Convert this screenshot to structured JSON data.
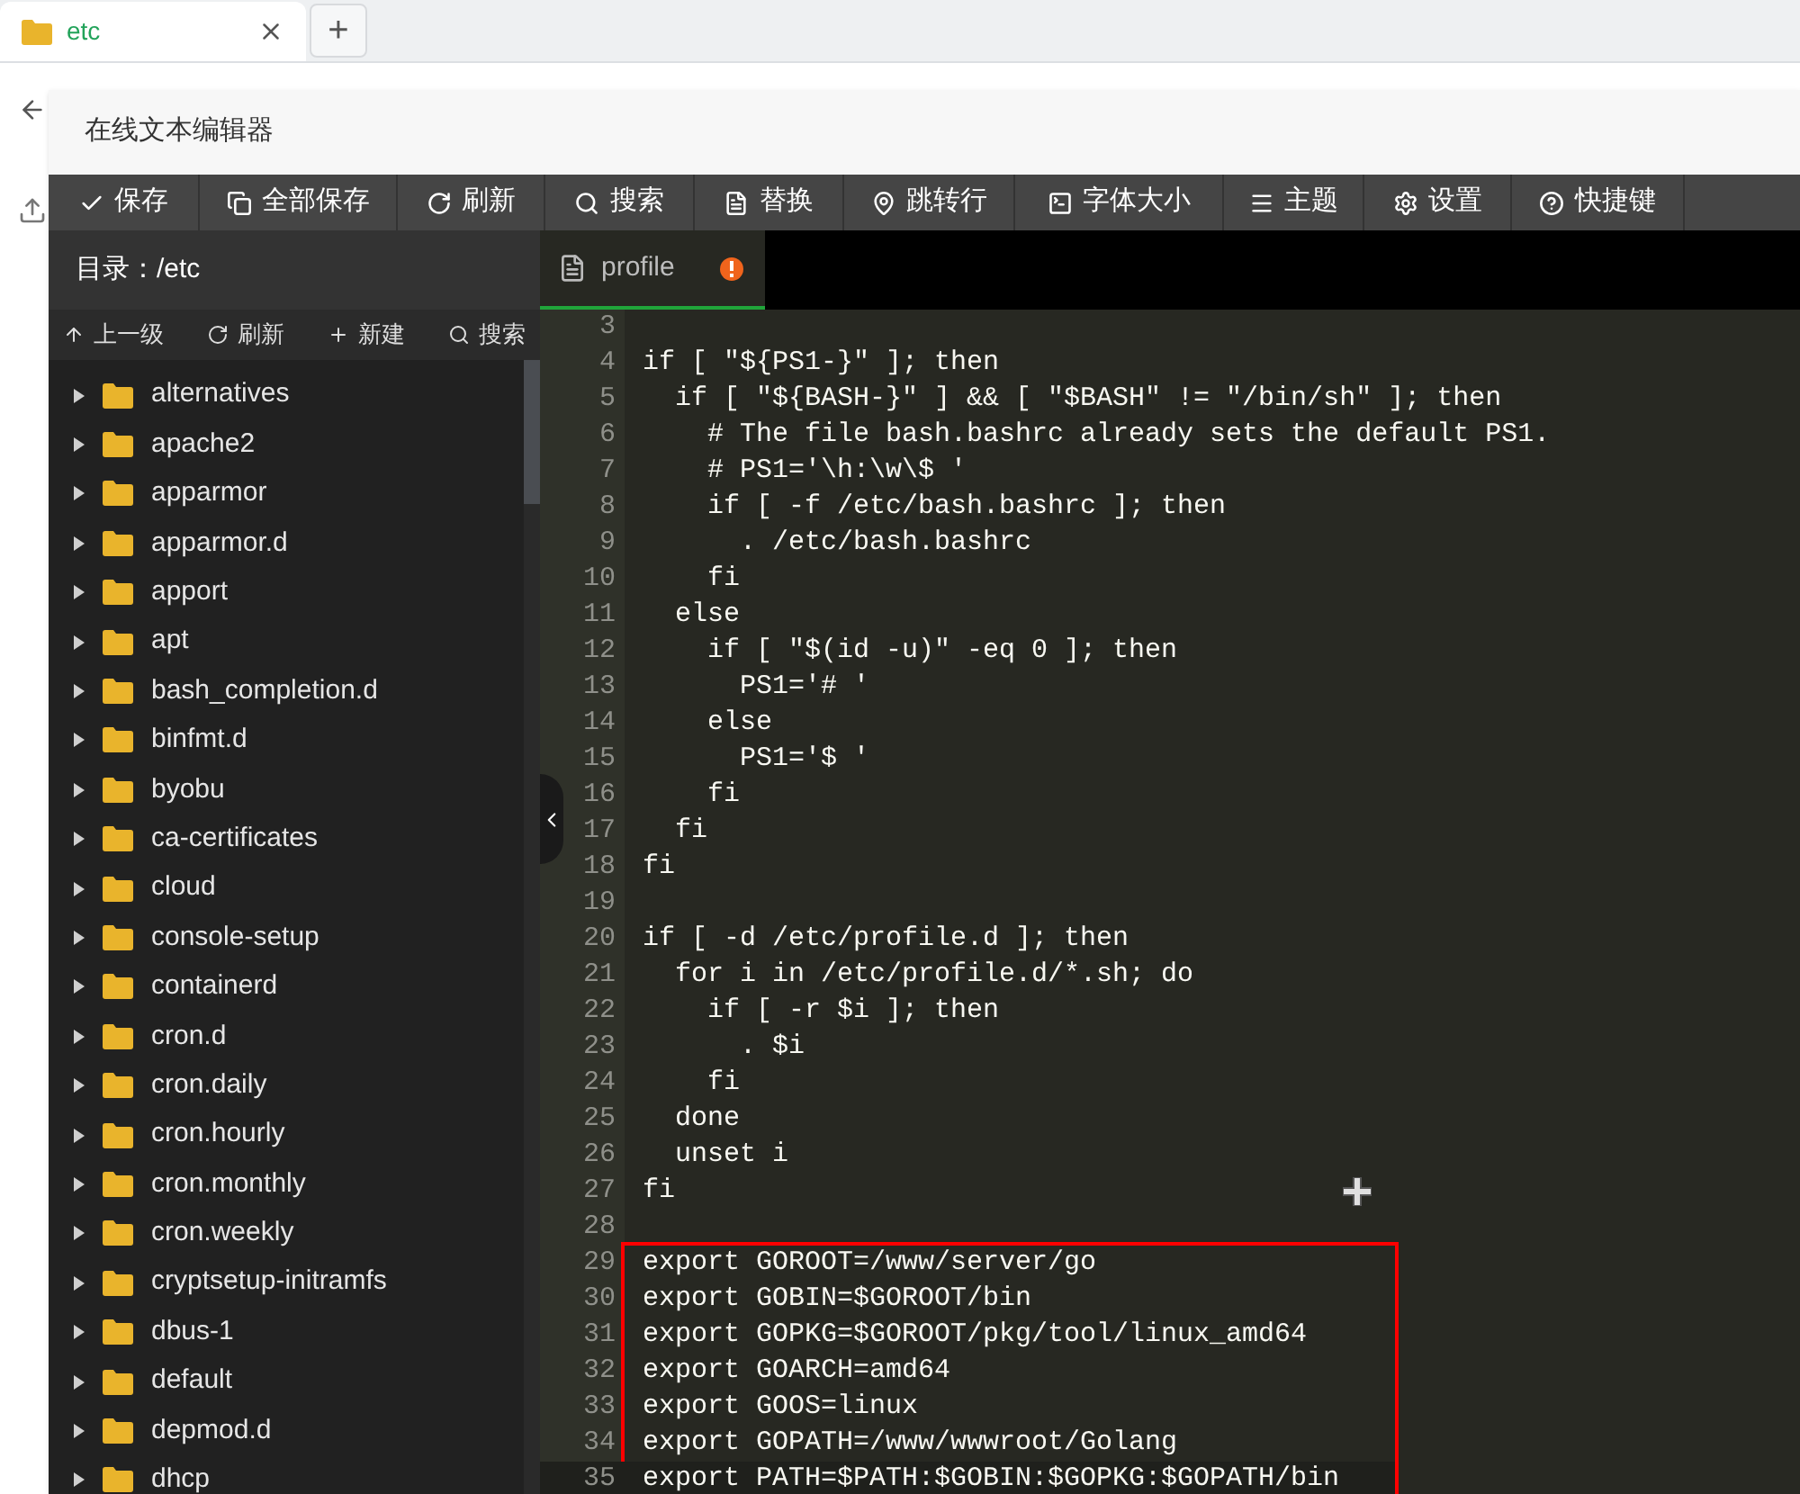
{
  "browser": {
    "tabs": [
      {
        "label": "etc",
        "selected": true
      }
    ],
    "new_tab": "+"
  },
  "window": {
    "title": "在线文本编辑器"
  },
  "toolbar": [
    {
      "label": "保存"
    },
    {
      "label": "全部保存"
    },
    {
      "label": "刷新"
    },
    {
      "label": "搜索"
    },
    {
      "label": "替换"
    },
    {
      "label": "跳转行"
    },
    {
      "label": "字体大小"
    },
    {
      "label": "主题"
    },
    {
      "label": "设置"
    },
    {
      "label": "快捷键"
    }
  ],
  "sidebar": {
    "path": "目录：/etc",
    "actions": [
      {
        "label": "上一级"
      },
      {
        "label": "刷新"
      },
      {
        "label": "新建"
      },
      {
        "label": "搜索"
      }
    ],
    "items": [
      {
        "label": "alternatives",
        "expanded": false
      },
      {
        "label": "apache2",
        "expanded": false
      },
      {
        "label": "apparmor",
        "expanded": false
      },
      {
        "label": "apparmor.d",
        "expanded": false
      },
      {
        "label": "apport",
        "expanded": false
      },
      {
        "label": "apt",
        "expanded": false
      },
      {
        "label": "bash_completion.d",
        "expanded": false
      },
      {
        "label": "binfmt.d",
        "expanded": false
      },
      {
        "label": "byobu",
        "expanded": false
      },
      {
        "label": "ca-certificates",
        "expanded": false
      },
      {
        "label": "cloud",
        "expanded": false
      },
      {
        "label": "console-setup",
        "expanded": false
      },
      {
        "label": "containerd",
        "expanded": false
      },
      {
        "label": "cron.d",
        "expanded": false
      },
      {
        "label": "cron.daily",
        "expanded": false
      },
      {
        "label": "cron.hourly",
        "expanded": false
      },
      {
        "label": "cron.monthly",
        "expanded": false
      },
      {
        "label": "cron.weekly",
        "expanded": false
      },
      {
        "label": "cryptsetup-initramfs",
        "expanded": false
      },
      {
        "label": "dbus-1",
        "expanded": false
      },
      {
        "label": "default",
        "expanded": false
      },
      {
        "label": "depmod.d",
        "expanded": false
      },
      {
        "label": "dhcp",
        "expanded": false
      }
    ]
  },
  "editor": {
    "tabs": [
      {
        "label": "profile",
        "selected": true,
        "modified": true
      }
    ],
    "lines": [
      {
        "number": "3",
        "boxed": false,
        "current": false
      },
      {
        "number": "4",
        "text": "if [ \"${PS1-}\" ]; then",
        "boxed": false,
        "current": false
      },
      {
        "number": "5",
        "text": "  if [ \"${BASH-}\" ] && [ \"$BASH\" != \"/bin/sh\" ]; then",
        "boxed": false,
        "current": false
      },
      {
        "number": "6",
        "text": "    # The file bash.bashrc already sets the default PS1.",
        "boxed": false,
        "current": false
      },
      {
        "number": "7",
        "text": "    # PS1='\\h:\\w\\$ '",
        "boxed": false,
        "current": false
      },
      {
        "number": "8",
        "text": "    if [ -f /etc/bash.bashrc ]; then",
        "boxed": false,
        "current": false
      },
      {
        "number": "9",
        "text": "      . /etc/bash.bashrc",
        "boxed": false,
        "current": false
      },
      {
        "number": "10",
        "text": "    fi",
        "boxed": false,
        "current": false
      },
      {
        "number": "11",
        "text": "  else",
        "boxed": false,
        "current": false
      },
      {
        "number": "12",
        "text": "    if [ \"$(id -u)\" -eq 0 ]; then",
        "boxed": false,
        "current": false
      },
      {
        "number": "13",
        "text": "      PS1='# '",
        "boxed": false,
        "current": false
      },
      {
        "number": "14",
        "text": "    else",
        "boxed": false,
        "current": false
      },
      {
        "number": "15",
        "text": "      PS1='$ '",
        "boxed": false,
        "current": false
      },
      {
        "number": "16",
        "text": "    fi",
        "boxed": false,
        "current": false
      },
      {
        "number": "17",
        "text": "  fi",
        "boxed": false,
        "current": false
      },
      {
        "number": "18",
        "text": "fi",
        "boxed": false,
        "current": false
      },
      {
        "number": "19",
        "boxed": false,
        "current": false
      },
      {
        "number": "20",
        "text": "if [ -d /etc/profile.d ]; then",
        "boxed": false,
        "current": false
      },
      {
        "number": "21",
        "text": "  for i in /etc/profile.d/*.sh; do",
        "boxed": false,
        "current": false
      },
      {
        "number": "22",
        "text": "    if [ -r $i ]; then",
        "boxed": false,
        "current": false
      },
      {
        "number": "23",
        "text": "      . $i",
        "boxed": false,
        "current": false
      },
      {
        "number": "24",
        "text": "    fi",
        "boxed": false,
        "current": false
      },
      {
        "number": "25",
        "text": "  done",
        "boxed": false,
        "current": false
      },
      {
        "number": "26",
        "text": "  unset i",
        "boxed": false,
        "current": false
      },
      {
        "number": "27",
        "text": "fi",
        "boxed": false,
        "current": false
      },
      {
        "number": "28",
        "boxed": false,
        "current": false
      },
      {
        "number": "29",
        "text": "export GOROOT=/www/server/go",
        "boxed": true,
        "current": false
      },
      {
        "number": "30",
        "text": "export GOBIN=$GOROOT/bin",
        "boxed": true,
        "current": false
      },
      {
        "number": "31",
        "text": "export GOPKG=$GOROOT/pkg/tool/linux_amd64",
        "boxed": true,
        "current": false
      },
      {
        "number": "32",
        "text": "export GOARCH=amd64",
        "boxed": true,
        "current": false
      },
      {
        "number": "33",
        "text": "export GOOS=linux",
        "boxed": true,
        "current": false
      },
      {
        "number": "34",
        "text": "export GOPATH=/www/wwwroot/Golang",
        "boxed": true,
        "current": false
      },
      {
        "number": "35",
        "text": "export PATH=$PATH:$GOBIN:$GOPKG:$GOPATH/bin",
        "boxed": true,
        "current": true
      }
    ]
  }
}
